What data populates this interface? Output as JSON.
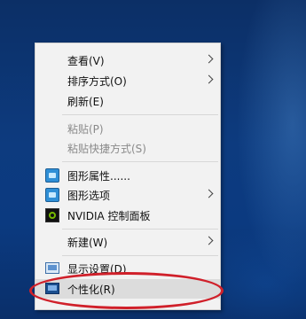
{
  "context_menu": {
    "items": [
      {
        "label": "查看(V)"
      },
      {
        "label": "排序方式(O)"
      },
      {
        "label": "刷新(E)"
      },
      {
        "label": "粘贴(P)"
      },
      {
        "label": "粘贴快捷方式(S)"
      },
      {
        "label": "图形属性......",
        "icon": "intel-graphics-icon"
      },
      {
        "label": "图形选项",
        "icon": "intel-graphics-icon"
      },
      {
        "label": "NVIDIA 控制面板",
        "icon": "nvidia-icon"
      },
      {
        "label": "新建(W)"
      },
      {
        "label": "显示设置(D)",
        "icon": "display-settings-icon"
      },
      {
        "label": "个性化(R)",
        "icon": "personalize-icon"
      }
    ]
  },
  "annotation": {
    "color": "#d0202a"
  }
}
